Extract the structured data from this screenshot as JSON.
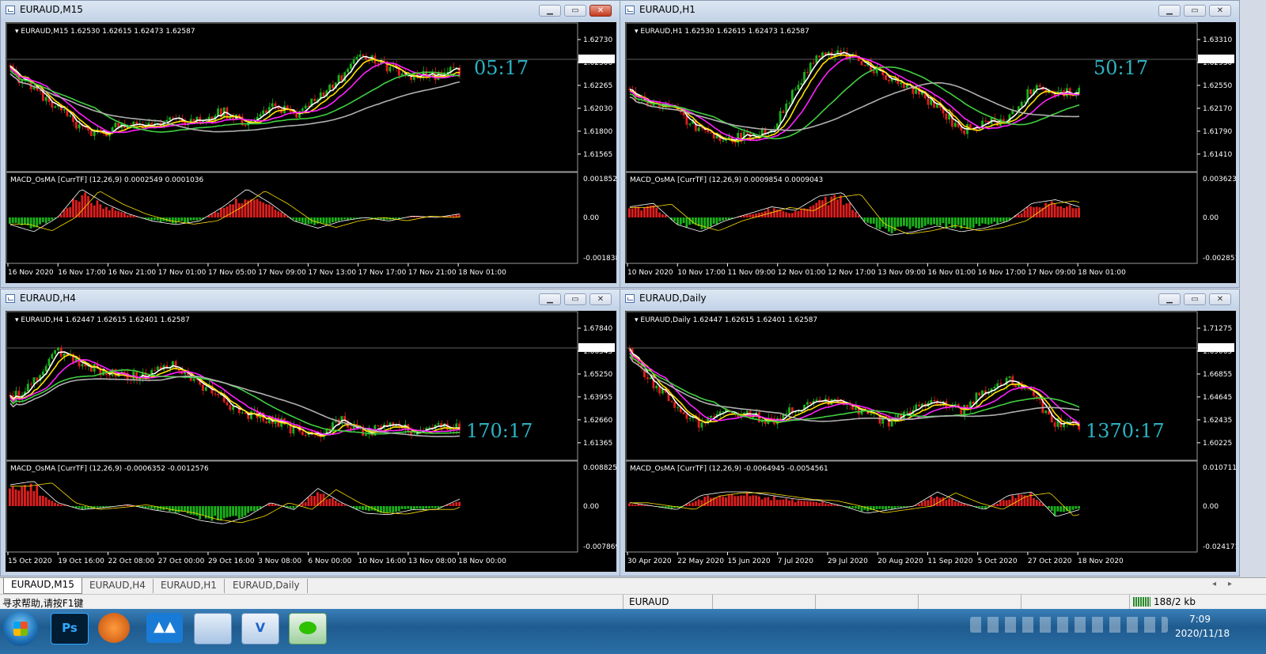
{
  "colors": {
    "bull": "#19b319",
    "bear": "#e01e1e",
    "white": "#ffffff",
    "yellow": "#ffe000",
    "magenta": "#ff20ff",
    "green": "#40d040",
    "silver": "#b0b0b0",
    "timer": "#2bb3c3",
    "grid": "#9a9a9a"
  },
  "windows": [
    {
      "title": "EURAUD,M15",
      "info": "EURAUD,M15  1.62530 1.62615 1.62473 1.62587",
      "price_ticks": [
        "1.62730",
        "1.62500",
        "1.62265",
        "1.62030",
        "1.61800",
        "1.61565"
      ],
      "current_price": "1.62587",
      "timer": "05:17",
      "macd_label": "MACD_OsMA [CurrTF] (12,26,9) 0.0002549 0.0001036",
      "macd_ticks": [
        "0.0018525",
        "0.00",
        "-0.001838"
      ],
      "time_labels": [
        "16 Nov 2020",
        "16 Nov 17:00",
        "16 Nov 21:00",
        "17 Nov 01:00",
        "17 Nov 05:00",
        "17 Nov 09:00",
        "17 Nov 13:00",
        "17 Nov 17:00",
        "17 Nov 21:00",
        "18 Nov 01:00"
      ],
      "close_active": true
    },
    {
      "title": "EURAUD,H1",
      "info": "EURAUD,H1  1.62530 1.62615 1.62473 1.62587",
      "price_ticks": [
        "1.63310",
        "1.62930",
        "1.62550",
        "1.62170",
        "1.61790",
        "1.61410"
      ],
      "current_price": "1.62587",
      "timer": "50:17",
      "macd_label": "MACD_OsMA [CurrTF] (12,26,9) 0.0009854 0.0009043",
      "macd_ticks": [
        "0.0036232",
        "0.00",
        "-0.0028514"
      ],
      "time_labels": [
        "10 Nov 2020",
        "10 Nov 17:00",
        "11 Nov 09:00",
        "12 Nov 01:00",
        "12 Nov 17:00",
        "13 Nov 09:00",
        "16 Nov 01:00",
        "16 Nov 17:00",
        "17 Nov 09:00",
        "18 Nov 01:00"
      ],
      "close_active": false
    },
    {
      "title": "EURAUD,H4",
      "info": "EURAUD,H4  1.62447 1.62615 1.62401 1.62587",
      "price_ticks": [
        "1.67840",
        "1.66545",
        "1.65250",
        "1.63955",
        "1.62660",
        "1.61365"
      ],
      "current_price": "1.62587",
      "timer": "170:17",
      "macd_label": "MACD_OsMA [CurrTF] (12,26,9) -0.0006352 -0.0012576",
      "macd_ticks": [
        "0.0088254",
        "0.00",
        "-0.007869"
      ],
      "time_labels": [
        "15 Oct 2020",
        "19 Oct 16:00",
        "22 Oct 08:00",
        "27 Oct 00:00",
        "29 Oct 16:00",
        "3 Nov 08:00",
        "6 Nov 00:00",
        "10 Nov 16:00",
        "13 Nov 08:00",
        "18 Nov 00:00"
      ],
      "close_active": false
    },
    {
      "title": "EURAUD,Daily",
      "info": "EURAUD,Daily  1.62447 1.62615 1.62401 1.62587",
      "price_ticks": [
        "1.71275",
        "1.69065",
        "1.66855",
        "1.64645",
        "1.62435",
        "1.60225"
      ],
      "current_price": "1.62587",
      "timer": "1370:17",
      "macd_label": "MACD_OsMA [CurrTF] (12,26,9) -0.0064945 -0.0054561",
      "macd_ticks": [
        "0.010711",
        "0.00",
        "-0.024171"
      ],
      "time_labels": [
        "30 Apr 2020",
        "22 May 2020",
        "15 Jun 2020",
        "7 Jul 2020",
        "29 Jul 2020",
        "20 Aug 2020",
        "11 Sep 2020",
        "5 Oct 2020",
        "27 Oct 2020",
        "18 Nov 2020"
      ],
      "close_active": false
    }
  ],
  "tabs": [
    {
      "label": "EURAUD,M15",
      "active": true
    },
    {
      "label": "EURAUD,H4",
      "active": false
    },
    {
      "label": "EURAUD,H1",
      "active": false
    },
    {
      "label": "EURAUD,Daily",
      "active": false
    }
  ],
  "status": {
    "help": "寻求帮助,请按F1键",
    "symbol": "EURAUD",
    "traffic": "188/2 kb"
  },
  "taskbar": {
    "apps": [
      "start-orb",
      "photoshop-icon",
      "browser-icon",
      "app-icon",
      "control-panel-icon",
      "vector-icon",
      "wechat-icon"
    ],
    "time": "7:09",
    "date": "2020/11/18"
  }
}
